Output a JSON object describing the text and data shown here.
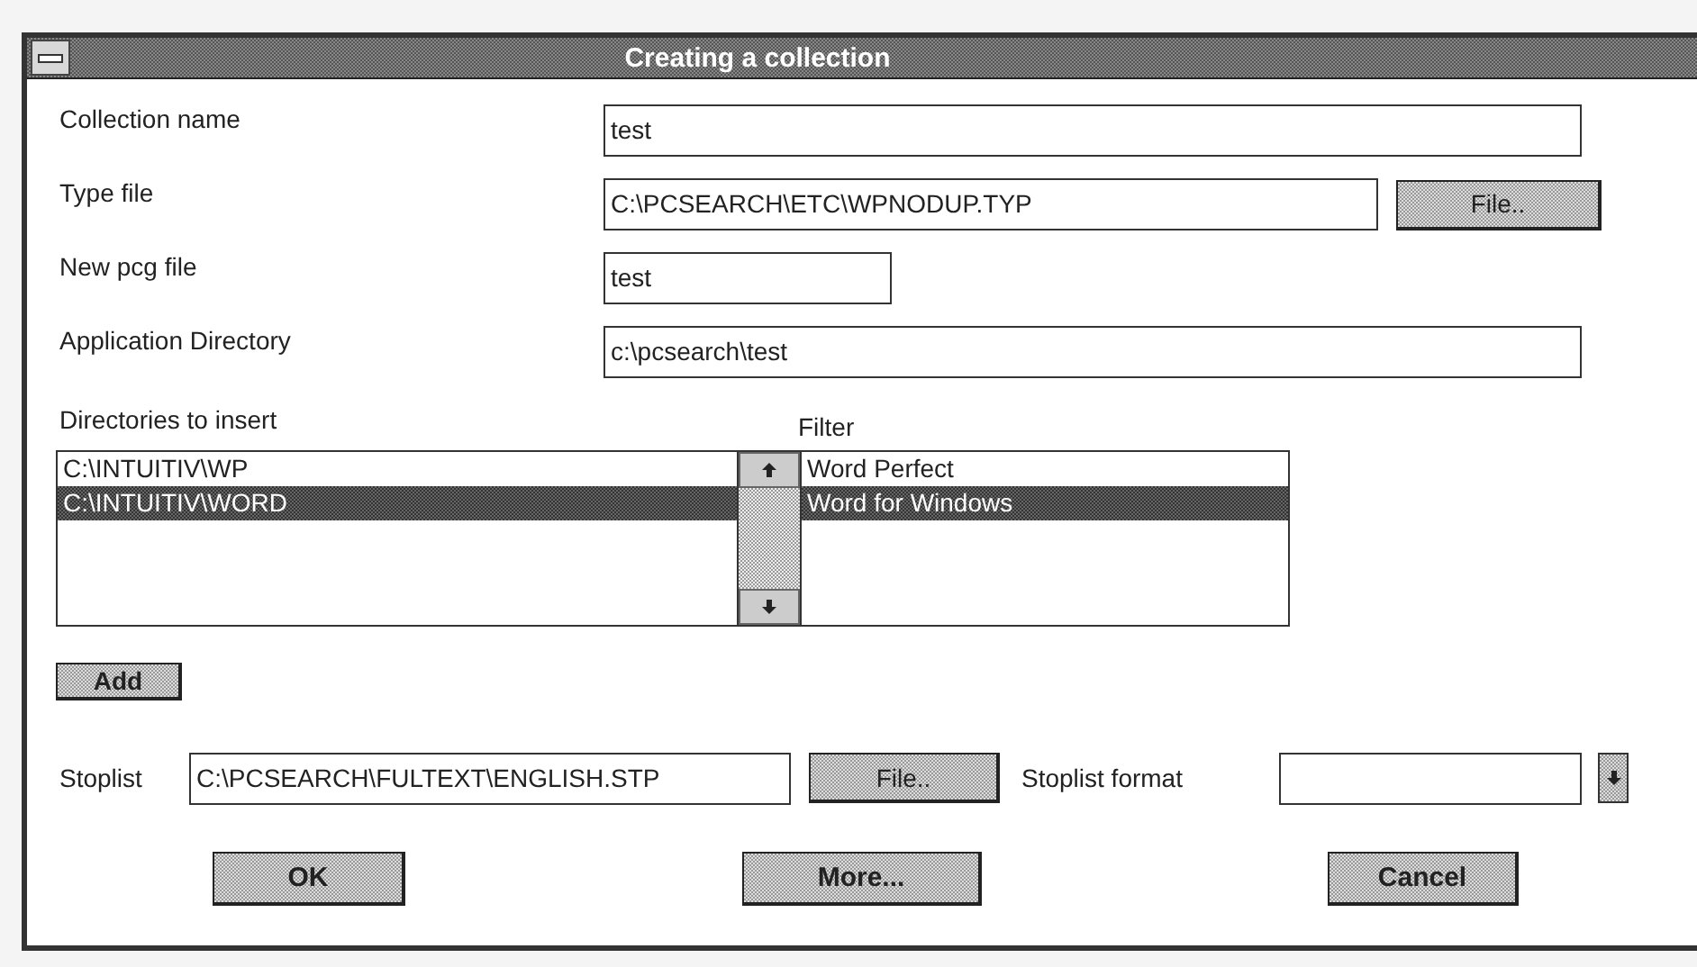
{
  "window": {
    "title": "Creating a collection"
  },
  "fields": [
    {
      "label": "Collection name",
      "value": "test"
    },
    {
      "label": "Type file",
      "value": "C:\\PCSEARCH\\ETC\\WPNODUP.TYP",
      "button": "File.."
    },
    {
      "label": "New pcg file",
      "value": "test"
    },
    {
      "label": "Application Directory",
      "value": "c:\\pcsearch\\test"
    }
  ],
  "directories": {
    "label": "Directories to insert",
    "items": [
      {
        "text": "C:\\INTUITIV\\WP",
        "selected": false
      },
      {
        "text": "C:\\INTUITIV\\WORD",
        "selected": true
      }
    ]
  },
  "filter": {
    "label": "Filter",
    "items": [
      {
        "text": "Word Perfect",
        "selected": false
      },
      {
        "text": "Word for Windows",
        "selected": true
      }
    ]
  },
  "add_button": "Add",
  "stoplist": {
    "label": "Stoplist",
    "value": "C:\\PCSEARCH\\FULTEXT\\ENGLISH.STP",
    "button": "File..",
    "format_label": "Stoplist format"
  },
  "buttons": [
    "OK",
    "More...",
    "Cancel"
  ]
}
